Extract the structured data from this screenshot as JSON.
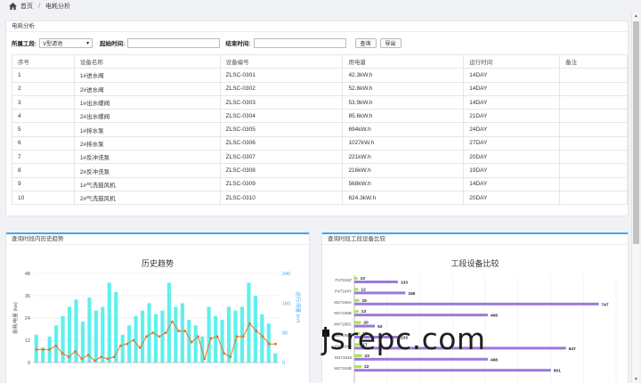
{
  "breadcrumb": {
    "home": "首页",
    "current": "电耗分析"
  },
  "top_panel": {
    "title": "电耗分析",
    "filters": {
      "section_label": "所属工段:",
      "section_value": "V型滤池",
      "start_label": "起始时间:",
      "end_label": "结束时间:",
      "query_button": "查询",
      "export_button": "导出"
    },
    "table": {
      "headers": [
        "序号",
        "设备名称",
        "设备编号",
        "用电量",
        "运行时间",
        "备注"
      ],
      "rows": [
        [
          "1",
          "1#进水阀",
          "ZLSC-0301",
          "42.3kW.h",
          "14DAY",
          ""
        ],
        [
          "2",
          "2#进水阀",
          "ZLSC-0302",
          "52.6kW.h",
          "14DAY",
          ""
        ],
        [
          "3",
          "1#出水蝶阀",
          "ZLSC-0303",
          "53.9kW.h",
          "14DAY",
          ""
        ],
        [
          "4",
          "2#出水蝶阀",
          "ZLSC-0304",
          "85.6kW.h",
          "21DAY",
          ""
        ],
        [
          "5",
          "1#排水泵",
          "ZLSC-0305",
          "694kW.h",
          "24DAY",
          ""
        ],
        [
          "6",
          "2#排水泵",
          "ZLSC-0306",
          "1027kW.h",
          "27DAY",
          ""
        ],
        [
          "7",
          "1#反冲洗泵",
          "ZLSC-0307",
          "221kW.h",
          "20DAY",
          ""
        ],
        [
          "8",
          "2#反冲洗泵",
          "ZLSC-0308",
          "216kW.h",
          "19DAY",
          ""
        ],
        [
          "9",
          "1#气洗鼓风机",
          "ZLSC-0309",
          "568kW.h",
          "14DAY",
          ""
        ],
        [
          "10",
          "2#气洗鼓风机",
          "ZLSC-0310",
          "624.3kW.h",
          "20DAY",
          ""
        ]
      ]
    }
  },
  "left_panel": {
    "title": "查询时段内历史趋势"
  },
  "right_panel": {
    "title": "查询时段工段设备比较"
  },
  "watermark": "jsrepc.com",
  "colors": {
    "bar": "#5ef0ec",
    "line": "#e8742a",
    "accent": "#3ea7f1",
    "hbar_purple": "#9b79d9",
    "hbar_green": "#a4e34a"
  },
  "chart_data": [
    {
      "type": "bar",
      "title": "历史趋势",
      "ylabel": "能耗/电量 (kw)",
      "y2label": "运行/流量 (m³)",
      "ylim": [
        0,
        48
      ],
      "y2lim": [
        0,
        240
      ],
      "yticks": [
        "0",
        "12",
        "24",
        "36",
        "48"
      ],
      "y2ticks": [
        "0",
        "80",
        "160",
        "240"
      ],
      "series": [
        {
          "values": [
            15,
            8,
            14,
            20,
            25,
            30,
            34,
            22,
            35,
            28,
            30,
            43,
            38,
            15,
            20,
            25,
            28,
            32,
            26,
            28,
            43,
            30,
            32,
            23,
            20,
            14,
            30,
            25,
            23,
            30,
            28,
            30,
            43,
            36,
            26,
            21,
            5
          ]
        },
        {
          "values": [
            7,
            7,
            7,
            9,
            5,
            3,
            6,
            2,
            4,
            1,
            3,
            2,
            3,
            9,
            10,
            12,
            8,
            14,
            16,
            14,
            16,
            22,
            17,
            17,
            11,
            14,
            2,
            13,
            14,
            5,
            3,
            14,
            14,
            21,
            17,
            14,
            10,
            10
          ]
        }
      ]
    },
    {
      "type": "bar",
      "title": "工段设备比较",
      "categories": [
        "P47184Z",
        "P47184Y",
        "M47186A",
        "M47186B",
        "M47186C",
        "M47186D",
        "P47184B",
        "M471848",
        "M47184B"
      ],
      "series": [
        {
          "values": [
            10,
            12,
            15,
            13,
            20,
            17,
            17,
            23,
            22
          ]
        },
        {
          "values": [
            133,
            156,
            747,
            408,
            63,
            133,
            647,
            408,
            601
          ]
        }
      ]
    }
  ]
}
